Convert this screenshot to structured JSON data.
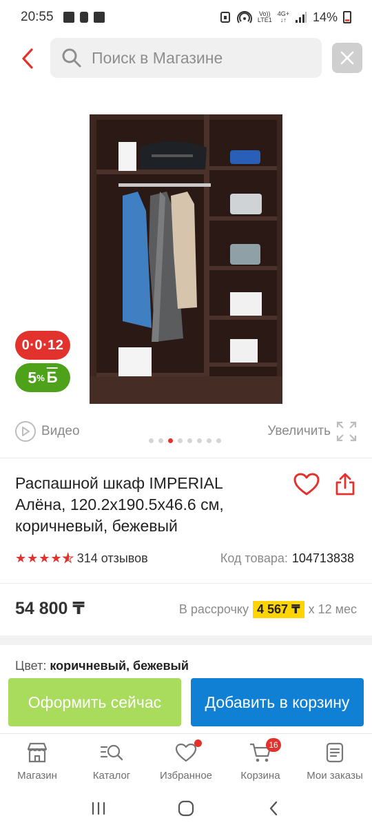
{
  "status_bar": {
    "time": "20:55",
    "battery": "14%",
    "network_top": "Vo))",
    "network_bottom": "LTE1",
    "network_gen": "4G+"
  },
  "search": {
    "placeholder": "Поиск в Магазине"
  },
  "gallery": {
    "badge_installment": "0·0·12",
    "badge_bonus_value": "5",
    "badge_bonus_percent": "%",
    "badge_bonus_letter": "Б",
    "video_label": "Видео",
    "zoom_label": "Увеличить",
    "dots_count": 8,
    "active_dot": 2
  },
  "product": {
    "title": "Распашной шкаф IMPERIAL Алёна, 120.2x190.5x46.6 см, коричневый, бежевый",
    "rating": 4.5,
    "reviews": "314 отзывов",
    "code_label": "Код товара:",
    "code_value": "104713838",
    "price": "54 800 ₸",
    "installment_prefix": "В рассрочку",
    "installment_amount": "4 567 ₸",
    "installment_suffix": "x 12 мес",
    "color_label": "Цвет:",
    "color_value": "коричневый, бежевый"
  },
  "actions": {
    "checkout": "Оформить сейчас",
    "add_to_cart": "Добавить в корзину"
  },
  "bottom_nav": {
    "items": [
      {
        "label": "Магазин",
        "icon": "shop-icon"
      },
      {
        "label": "Каталог",
        "icon": "catalog-search-icon"
      },
      {
        "label": "Избранное",
        "icon": "heart-icon"
      },
      {
        "label": "Корзина",
        "icon": "cart-icon"
      },
      {
        "label": "Мои заказы",
        "icon": "orders-icon"
      }
    ],
    "cart_count": "16"
  },
  "colors": {
    "accent_red": "#e2322e",
    "bonus_green": "#4ea21a",
    "checkout_green": "#a9db5d",
    "cart_blue": "#1080d4",
    "installment_yellow": "#ffd400"
  }
}
